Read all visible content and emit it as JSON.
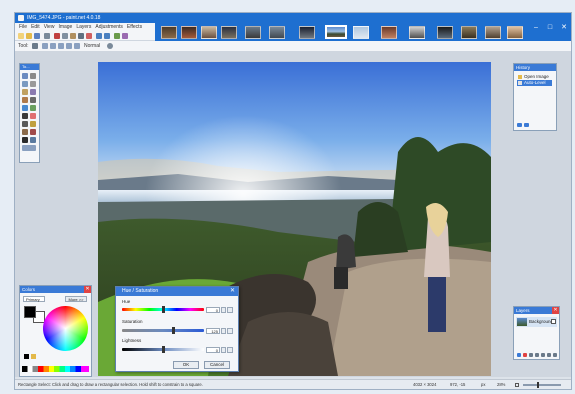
{
  "window": {
    "title": "IMG_5474.JPG - paint.net 4.0.18",
    "minimize": "–",
    "restore": "□",
    "close": "✕"
  },
  "menu": [
    "File",
    "Edit",
    "View",
    "Image",
    "Layers",
    "Adjustments",
    "Effects"
  ],
  "toolbar": {
    "tool_label": "Tool:",
    "blend_mode": "Normal"
  },
  "tools_panel": {
    "title": "To..."
  },
  "history_panel": {
    "title": "History",
    "items": [
      "Open Image",
      "Auto-Level"
    ],
    "selected_index": 1
  },
  "colors_panel": {
    "title": "Colors",
    "primary_select": "Primary",
    "more_button": "More >>",
    "primary_color": "#000000",
    "secondary_color": "#ffffff"
  },
  "layers_panel": {
    "title": "Layers",
    "layer_name": "Background"
  },
  "hue_sat_dialog": {
    "title": "Hue / Saturation",
    "hue_label": "Hue",
    "hue_value": "0",
    "hue_fraction": 0.5,
    "saturation_label": "Saturation",
    "saturation_value": "125",
    "saturation_fraction": 0.625,
    "lightness_label": "Lightness",
    "lightness_value": "0",
    "lightness_fraction": 0.5,
    "ok_label": "OK",
    "cancel_label": "Cancel"
  },
  "status": {
    "hint": "Rectangle Select: Click and drag to draw a rectangular selection. Hold shift to constrain to a square.",
    "image_size": "4032 × 3024",
    "cursor_pos": "972, -15",
    "units": "px",
    "zoom": "28%"
  },
  "colors": {
    "titlebar": "#1e6fd0",
    "accent": "#3a7ad6",
    "close_red": "#e04343"
  }
}
